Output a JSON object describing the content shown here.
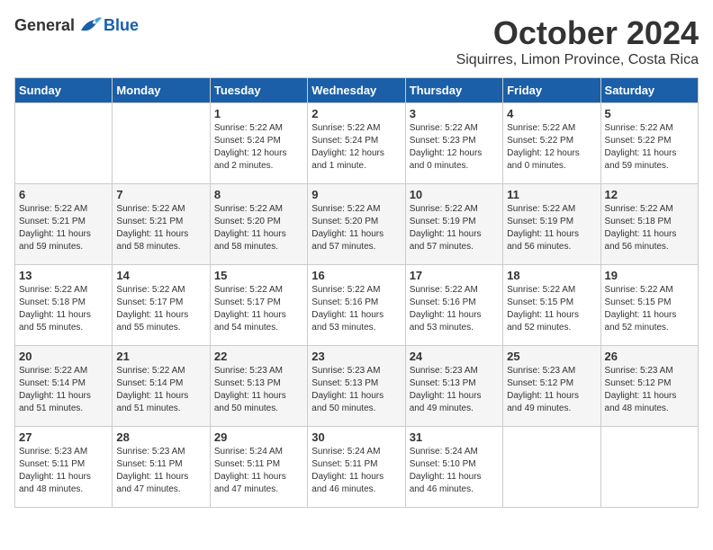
{
  "header": {
    "logo_general": "General",
    "logo_blue": "Blue",
    "month_title": "October 2024",
    "location": "Siquirres, Limon Province, Costa Rica"
  },
  "weekdays": [
    "Sunday",
    "Monday",
    "Tuesday",
    "Wednesday",
    "Thursday",
    "Friday",
    "Saturday"
  ],
  "weeks": [
    [
      {
        "day": "",
        "info": ""
      },
      {
        "day": "",
        "info": ""
      },
      {
        "day": "1",
        "info": "Sunrise: 5:22 AM\nSunset: 5:24 PM\nDaylight: 12 hours\nand 2 minutes."
      },
      {
        "day": "2",
        "info": "Sunrise: 5:22 AM\nSunset: 5:24 PM\nDaylight: 12 hours\nand 1 minute."
      },
      {
        "day": "3",
        "info": "Sunrise: 5:22 AM\nSunset: 5:23 PM\nDaylight: 12 hours\nand 0 minutes."
      },
      {
        "day": "4",
        "info": "Sunrise: 5:22 AM\nSunset: 5:22 PM\nDaylight: 12 hours\nand 0 minutes."
      },
      {
        "day": "5",
        "info": "Sunrise: 5:22 AM\nSunset: 5:22 PM\nDaylight: 11 hours\nand 59 minutes."
      }
    ],
    [
      {
        "day": "6",
        "info": "Sunrise: 5:22 AM\nSunset: 5:21 PM\nDaylight: 11 hours\nand 59 minutes."
      },
      {
        "day": "7",
        "info": "Sunrise: 5:22 AM\nSunset: 5:21 PM\nDaylight: 11 hours\nand 58 minutes."
      },
      {
        "day": "8",
        "info": "Sunrise: 5:22 AM\nSunset: 5:20 PM\nDaylight: 11 hours\nand 58 minutes."
      },
      {
        "day": "9",
        "info": "Sunrise: 5:22 AM\nSunset: 5:20 PM\nDaylight: 11 hours\nand 57 minutes."
      },
      {
        "day": "10",
        "info": "Sunrise: 5:22 AM\nSunset: 5:19 PM\nDaylight: 11 hours\nand 57 minutes."
      },
      {
        "day": "11",
        "info": "Sunrise: 5:22 AM\nSunset: 5:19 PM\nDaylight: 11 hours\nand 56 minutes."
      },
      {
        "day": "12",
        "info": "Sunrise: 5:22 AM\nSunset: 5:18 PM\nDaylight: 11 hours\nand 56 minutes."
      }
    ],
    [
      {
        "day": "13",
        "info": "Sunrise: 5:22 AM\nSunset: 5:18 PM\nDaylight: 11 hours\nand 55 minutes."
      },
      {
        "day": "14",
        "info": "Sunrise: 5:22 AM\nSunset: 5:17 PM\nDaylight: 11 hours\nand 55 minutes."
      },
      {
        "day": "15",
        "info": "Sunrise: 5:22 AM\nSunset: 5:17 PM\nDaylight: 11 hours\nand 54 minutes."
      },
      {
        "day": "16",
        "info": "Sunrise: 5:22 AM\nSunset: 5:16 PM\nDaylight: 11 hours\nand 53 minutes."
      },
      {
        "day": "17",
        "info": "Sunrise: 5:22 AM\nSunset: 5:16 PM\nDaylight: 11 hours\nand 53 minutes."
      },
      {
        "day": "18",
        "info": "Sunrise: 5:22 AM\nSunset: 5:15 PM\nDaylight: 11 hours\nand 52 minutes."
      },
      {
        "day": "19",
        "info": "Sunrise: 5:22 AM\nSunset: 5:15 PM\nDaylight: 11 hours\nand 52 minutes."
      }
    ],
    [
      {
        "day": "20",
        "info": "Sunrise: 5:22 AM\nSunset: 5:14 PM\nDaylight: 11 hours\nand 51 minutes."
      },
      {
        "day": "21",
        "info": "Sunrise: 5:22 AM\nSunset: 5:14 PM\nDaylight: 11 hours\nand 51 minutes."
      },
      {
        "day": "22",
        "info": "Sunrise: 5:23 AM\nSunset: 5:13 PM\nDaylight: 11 hours\nand 50 minutes."
      },
      {
        "day": "23",
        "info": "Sunrise: 5:23 AM\nSunset: 5:13 PM\nDaylight: 11 hours\nand 50 minutes."
      },
      {
        "day": "24",
        "info": "Sunrise: 5:23 AM\nSunset: 5:13 PM\nDaylight: 11 hours\nand 49 minutes."
      },
      {
        "day": "25",
        "info": "Sunrise: 5:23 AM\nSunset: 5:12 PM\nDaylight: 11 hours\nand 49 minutes."
      },
      {
        "day": "26",
        "info": "Sunrise: 5:23 AM\nSunset: 5:12 PM\nDaylight: 11 hours\nand 48 minutes."
      }
    ],
    [
      {
        "day": "27",
        "info": "Sunrise: 5:23 AM\nSunset: 5:11 PM\nDaylight: 11 hours\nand 48 minutes."
      },
      {
        "day": "28",
        "info": "Sunrise: 5:23 AM\nSunset: 5:11 PM\nDaylight: 11 hours\nand 47 minutes."
      },
      {
        "day": "29",
        "info": "Sunrise: 5:24 AM\nSunset: 5:11 PM\nDaylight: 11 hours\nand 47 minutes."
      },
      {
        "day": "30",
        "info": "Sunrise: 5:24 AM\nSunset: 5:11 PM\nDaylight: 11 hours\nand 46 minutes."
      },
      {
        "day": "31",
        "info": "Sunrise: 5:24 AM\nSunset: 5:10 PM\nDaylight: 11 hours\nand 46 minutes."
      },
      {
        "day": "",
        "info": ""
      },
      {
        "day": "",
        "info": ""
      }
    ]
  ]
}
